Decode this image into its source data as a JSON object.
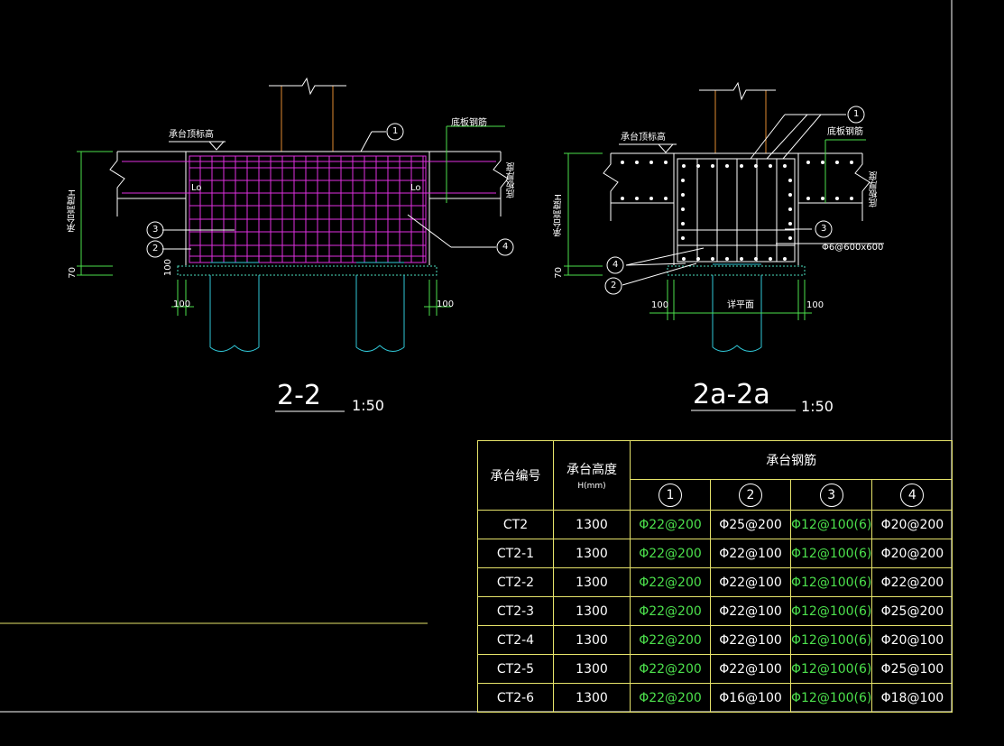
{
  "section_left": {
    "title": "2-2",
    "scale": "1:50",
    "dims": {
      "left_offset": "100",
      "right_offset": "100",
      "bottom_70": "70",
      "cushion": "100",
      "height_label": "承台高度H"
    },
    "labels": {
      "top_bar": "承台顶标高",
      "bottom_bar": "底板钢筋",
      "slab_thk": "底板厚度",
      "lo_left": "Lo",
      "lo_right": "Lo"
    },
    "markers": [
      "1",
      "2",
      "3",
      "4"
    ]
  },
  "section_right": {
    "title": "2a-2a",
    "scale": "1:50",
    "dims": {
      "left_offset": "100",
      "right_offset": "100",
      "bottom_70": "70",
      "pile_dia": "详平面",
      "height_label": "承台高度H"
    },
    "labels": {
      "top_bar": "承台顶标高",
      "bottom_bar": "底板钢筋",
      "slab_thk": "底板厚度",
      "tie": "Φ6@600x600"
    },
    "markers": [
      "1",
      "2",
      "3",
      "4"
    ]
  },
  "table": {
    "headers": {
      "id": "承台编号",
      "height": "承台高度",
      "height_unit": "H(mm)",
      "rebar": "承台钢筋",
      "cols": [
        "1",
        "2",
        "3",
        "4"
      ]
    },
    "rows": [
      {
        "id": "CT2",
        "h": "1300",
        "r1": "Φ22@200",
        "r2": "Φ25@200",
        "r3": "Φ12@100(6)",
        "r4": "Φ20@200"
      },
      {
        "id": "CT2-1",
        "h": "1300",
        "r1": "Φ22@200",
        "r2": "Φ22@100",
        "r3": "Φ12@100(6)",
        "r4": "Φ20@200"
      },
      {
        "id": "CT2-2",
        "h": "1300",
        "r1": "Φ22@200",
        "r2": "Φ22@100",
        "r3": "Φ12@100(6)",
        "r4": "Φ22@200"
      },
      {
        "id": "CT2-3",
        "h": "1300",
        "r1": "Φ22@200",
        "r2": "Φ22@100",
        "r3": "Φ12@100(6)",
        "r4": "Φ25@200"
      },
      {
        "id": "CT2-4",
        "h": "1300",
        "r1": "Φ22@200",
        "r2": "Φ22@100",
        "r3": "Φ12@100(6)",
        "r4": "Φ20@100"
      },
      {
        "id": "CT2-5",
        "h": "1300",
        "r1": "Φ22@200",
        "r2": "Φ22@100",
        "r3": "Φ12@100(6)",
        "r4": "Φ25@100"
      },
      {
        "id": "CT2-6",
        "h": "1300",
        "r1": "Φ22@200",
        "r2": "Φ16@100",
        "r3": "Φ12@100(6)",
        "r4": "Φ18@100"
      }
    ]
  },
  "colors": {
    "background": "#000000",
    "border": "#e6e36a",
    "concrete": "#ffffff",
    "rebar_main": "#e030e0",
    "pile": "#30c8d8",
    "column": "#e08a30",
    "dim": "#4ce04c"
  }
}
